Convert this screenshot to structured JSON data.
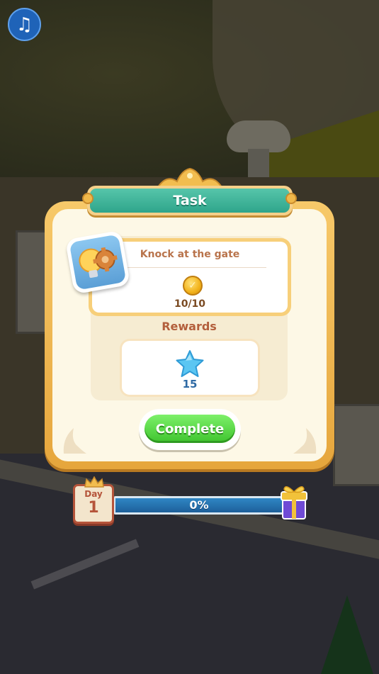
{
  "music_button": {
    "icon": "music-note-icon",
    "glyph": "♫"
  },
  "dialog": {
    "title": "Task",
    "task": {
      "label": "Knock at the gate",
      "icon": "lightbulb-gear-icon",
      "progress_text": "10/10",
      "currency_icon": "coin-icon"
    },
    "rewards_label": "Rewards",
    "reward": {
      "icon": "star-icon",
      "amount": "15"
    },
    "complete_label": "Complete"
  },
  "day_progress": {
    "day_label": "Day",
    "day_number": "1",
    "percent_text": "0%",
    "percent_value": 0,
    "reward_icon": "gift-box-icon"
  },
  "colors": {
    "title_teal": "#2fa58b",
    "panel_gold": "#f7c96a",
    "complete_green": "#3fc42e",
    "progress_blue": "#1d5f9a"
  }
}
